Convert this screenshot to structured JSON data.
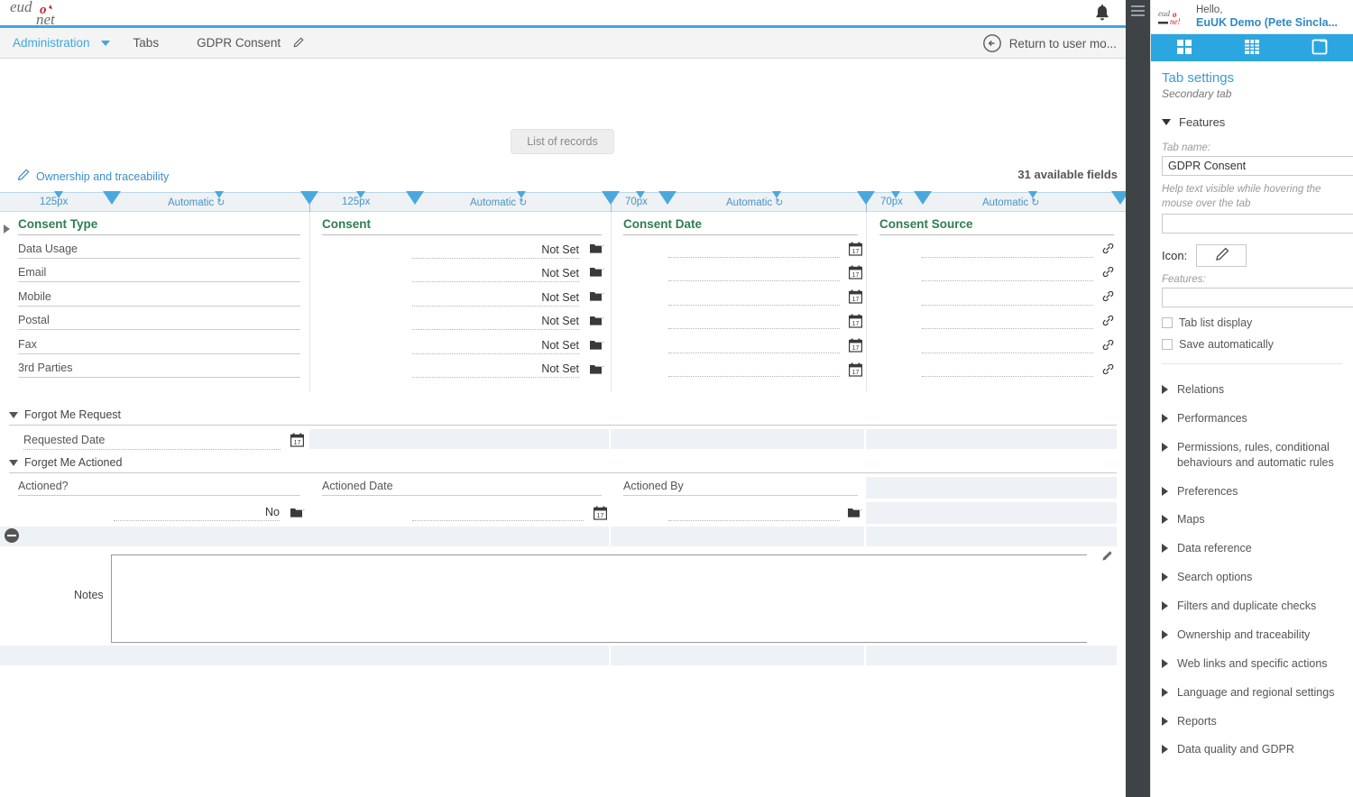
{
  "app": {
    "logo_text_top": "eudo",
    "logo_text_bottom": "net",
    "bell_icon": "bell-icon"
  },
  "breadcrumb": {
    "administration": "Administration",
    "tabs": "Tabs",
    "current": "GDPR Consent",
    "edit_icon": "pencil-icon",
    "return_label": "Return to user mo...",
    "return_icon": "back-circle-arrow-icon"
  },
  "toolbar": {
    "list_of_records": "List of records",
    "ownership_traceability": "Ownership and traceability",
    "ownership_icon": "pencil-icon",
    "available_fields": "31 available fields"
  },
  "ruler": {
    "segments": [
      {
        "label": "125px",
        "mode": ""
      },
      {
        "label": "Automatic",
        "mode": "refresh-icon"
      },
      {
        "label": "125px",
        "mode": ""
      },
      {
        "label": "Automatic",
        "mode": "refresh-icon"
      },
      {
        "label": "70px",
        "mode": ""
      },
      {
        "label": "Automatic",
        "mode": "refresh-icon"
      },
      {
        "label": "70px",
        "mode": ""
      },
      {
        "label": "Automatic",
        "mode": "refresh-icon"
      }
    ]
  },
  "form": {
    "headers": [
      "Consent Type",
      "Consent",
      "Consent Date",
      "Consent Source"
    ],
    "rows": [
      {
        "type": "Data Usage",
        "consent": "Not Set",
        "date": "",
        "source": ""
      },
      {
        "type": "Email",
        "consent": "Not Set",
        "date": "",
        "source": ""
      },
      {
        "type": "Mobile",
        "consent": "Not Set",
        "date": "",
        "source": ""
      },
      {
        "type": "Postal",
        "consent": "Not Set",
        "date": "",
        "source": ""
      },
      {
        "type": "Fax",
        "consent": "Not Set",
        "date": "",
        "source": ""
      },
      {
        "type": "3rd Parties",
        "consent": "Not Set",
        "date": "",
        "source": ""
      }
    ],
    "section_forgot_request": "Forgot Me Request",
    "requested_date_label": "Requested Date",
    "requested_date_value": "",
    "section_forget_actioned": "Forget Me Actioned",
    "actioned_label": "Actioned?",
    "actioned_value": "No",
    "actioned_date_label": "Actioned Date",
    "actioned_date_value": "",
    "actioned_by_label": "Actioned By",
    "actioned_by_value": "",
    "notes_label": "Notes",
    "notes_value": "",
    "notes_edit_icon": "pencil-icon",
    "collapse_icon": "minus-circle-icon",
    "folder_icon": "folder-dropdown-icon",
    "calendar_icon": "calendar-17-icon",
    "link_icon": "chain-link-icon"
  },
  "sidebar": {
    "hello": "Hello,",
    "user": "EuUK Demo (Pete Sincla...",
    "tabs": [
      {
        "name": "grid-view-icon",
        "active": false
      },
      {
        "name": "table-view-icon",
        "active": false
      },
      {
        "name": "tab-settings-icon",
        "active": true
      }
    ],
    "title": "Tab settings",
    "subtitle": "Secondary tab",
    "features_header": "Features",
    "tab_name_caption": "Tab name:",
    "tab_name_value": "GDPR Consent",
    "help_text_caption": "Help text visible while hovering the mouse over the tab",
    "help_text_value": "",
    "icon_label": "Icon:",
    "icon_button": "pencil-icon",
    "features_caption": "Features:",
    "features_value": "",
    "checkbox_tab_list": "Tab list display",
    "checkbox_save_auto": "Save automatically",
    "accordion": [
      "Relations",
      "Performances",
      "Permissions, rules, conditional behaviours and automatic rules",
      "Preferences",
      "Maps",
      "Data reference",
      "Search options",
      "Filters and duplicate checks",
      "Ownership and traceability",
      "Web links and specific actions",
      "Language and regional settings",
      "Reports",
      "Data quality and GDPR"
    ]
  },
  "colors": {
    "accent_blue": "#2ca6e0",
    "header_green": "#2f7d51",
    "rail_dark": "#3e4346",
    "logo_red": "#cc2229"
  }
}
